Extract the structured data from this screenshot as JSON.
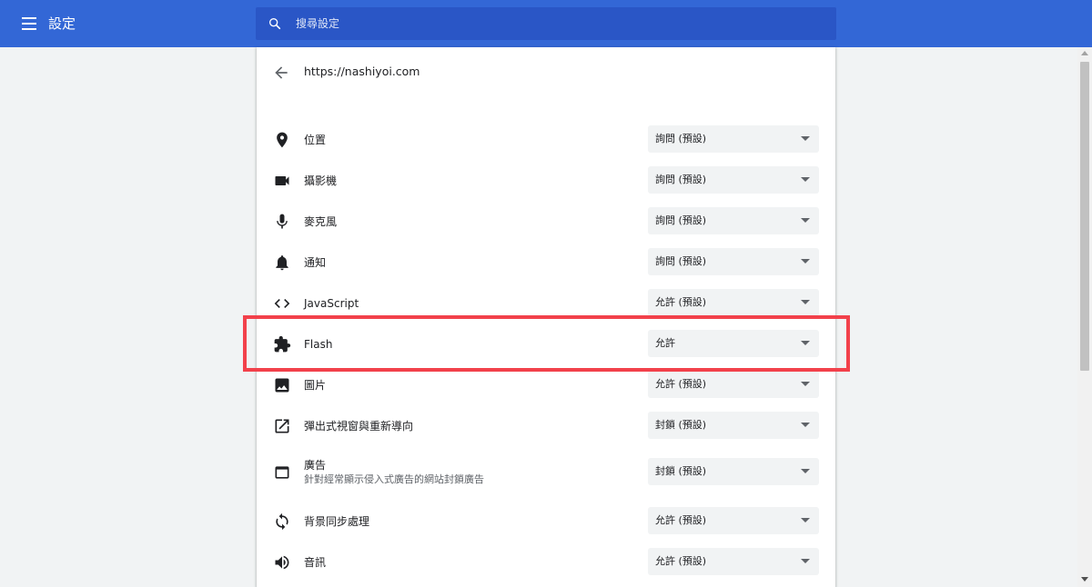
{
  "header": {
    "title": "設定",
    "search_placeholder": "搜尋設定",
    "menu_icon": "hamburger-menu-icon",
    "search_icon": "search-icon"
  },
  "site": {
    "url": "https://nashiyoi.com",
    "back_icon": "arrow-back-icon"
  },
  "permissions": [
    {
      "icon": "location-pin-icon",
      "label": "位置",
      "value": "詢問 (預設)"
    },
    {
      "icon": "camera-icon",
      "label": "攝影機",
      "value": "詢問 (預設)"
    },
    {
      "icon": "microphone-icon",
      "label": "麥克風",
      "value": "詢問 (預設)"
    },
    {
      "icon": "bell-icon",
      "label": "通知",
      "value": "詢問 (預設)"
    },
    {
      "icon": "code-icon",
      "label": "JavaScript",
      "value": "允許 (預設)"
    },
    {
      "icon": "puzzle-piece-icon",
      "label": "Flash",
      "value": "允許",
      "highlighted": true
    },
    {
      "icon": "image-icon",
      "label": "圖片",
      "value": "允許 (預設)"
    },
    {
      "icon": "open-in-new-icon",
      "label": "彈出式視窗與重新導向",
      "value": "封鎖 (預設)"
    },
    {
      "icon": "web-ad-icon",
      "label": "廣告",
      "sublabel": "針對經常顯示侵入式廣告的網站封鎖廣告",
      "value": "封鎖 (預設)"
    },
    {
      "icon": "sync-icon",
      "label": "背景同步處理",
      "value": "允許 (預設)"
    },
    {
      "icon": "speaker-icon",
      "label": "音訊",
      "value": "允許 (預設)"
    }
  ],
  "colors": {
    "header_bg": "#3367d6",
    "search_bg": "#2a56c6",
    "page_bg": "#f1f3f4",
    "card_bg": "#ffffff",
    "select_bg": "#f1f3f4",
    "highlight_border": "#f2414b",
    "icon_color": "#5f6368"
  }
}
